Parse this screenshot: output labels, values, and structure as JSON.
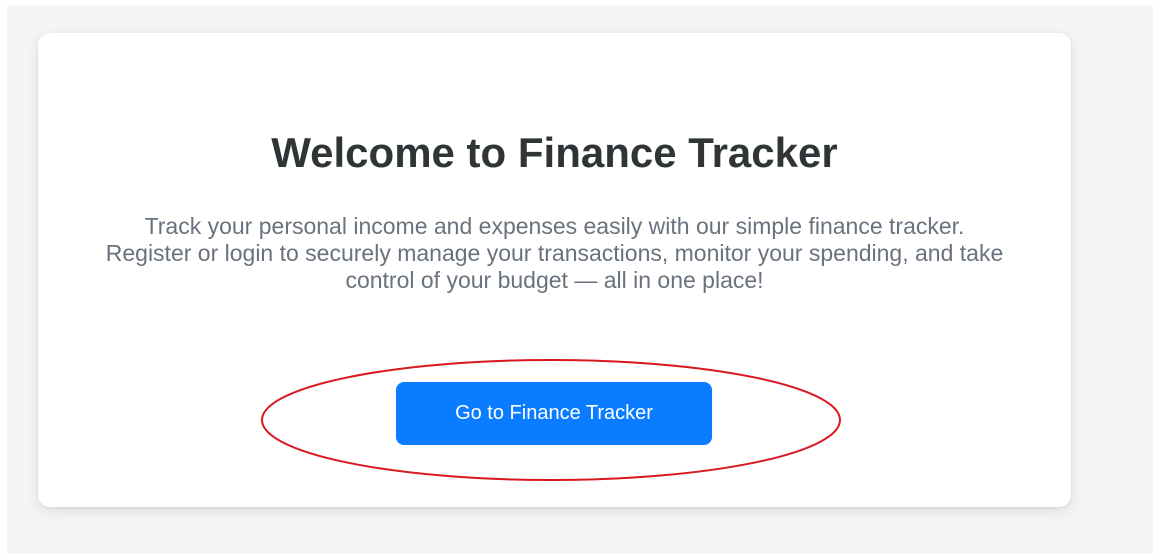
{
  "welcome": {
    "title": "Welcome to Finance Tracker",
    "description": "Track your personal income and expenses easily with our simple finance tracker. Register or login to securely manage your transactions, monitor your spending, and take control of your budget — all in one place!",
    "cta_label": "Go to Finance Tracker"
  },
  "colors": {
    "page_background": "#f4f5f7",
    "card_background": "#ffffff",
    "title": "#2f3437",
    "description": "#69727d",
    "button": "#0a7cff",
    "button_text": "#ffffff",
    "highlight_annotation": "#d9181f"
  }
}
